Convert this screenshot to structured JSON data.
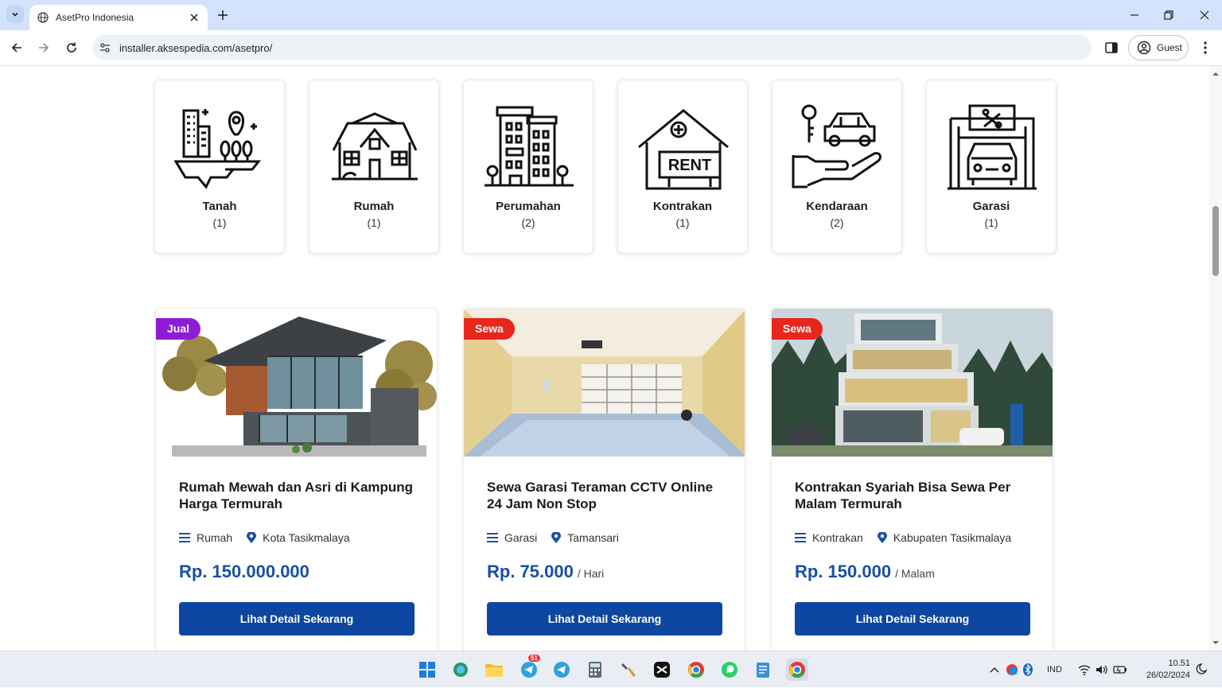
{
  "browser": {
    "tab_title": "AsetPro Indonesia",
    "url": "installer.aksespedia.com/asetpro/",
    "profile_label": "Guest"
  },
  "categories": [
    {
      "name": "Tanah",
      "count": "(1)",
      "icon": "land-icon"
    },
    {
      "name": "Rumah",
      "count": "(1)",
      "icon": "house-icon"
    },
    {
      "name": "Perumahan",
      "count": "(2)",
      "icon": "housing-complex-icon"
    },
    {
      "name": "Kontrakan",
      "count": "(1)",
      "icon": "rent-house-icon"
    },
    {
      "name": "Kendaraan",
      "count": "(2)",
      "icon": "vehicle-icon"
    },
    {
      "name": "Garasi",
      "count": "(1)",
      "icon": "garage-icon"
    }
  ],
  "rent_sign_text": "RENT",
  "listings": [
    {
      "badge": "Jual",
      "badge_color": "#8e1bd6",
      "title": "Rumah Mewah dan Asri di Kampung Harga Termurah",
      "category": "Rumah",
      "location": "Kota Tasikmalaya",
      "price": "Rp. 150.000.000",
      "unit": "",
      "button": "Lihat Detail Sekarang",
      "image": "modern-house-photo"
    },
    {
      "badge": "Sewa",
      "badge_color": "#e8261c",
      "title": "Sewa Garasi Teraman CCTV Online 24 Jam Non Stop",
      "category": "Garasi",
      "location": "Tamansari",
      "price": "Rp. 75.000",
      "unit": "/ Hari",
      "button": "Lihat Detail Sekarang",
      "image": "garage-interior-photo"
    },
    {
      "badge": "Sewa",
      "badge_color": "#e8261c",
      "title": "Kontrakan Syariah Bisa Sewa Per Malam Termurah",
      "category": "Kontrakan",
      "location": "Kabupaten Tasikmalaya",
      "price": "Rp. 150.000",
      "unit": "/ Malam",
      "button": "Lihat Detail Sekarang",
      "image": "modern-villa-photo"
    }
  ],
  "taskbar": {
    "telegram_badge": "51",
    "language": "IND",
    "time": "10.51",
    "date": "26/02/2024"
  },
  "colors": {
    "primary_button": "#0d47a1",
    "price_text": "#1a4fa3",
    "tabbar_bg": "#d3e3fd"
  }
}
